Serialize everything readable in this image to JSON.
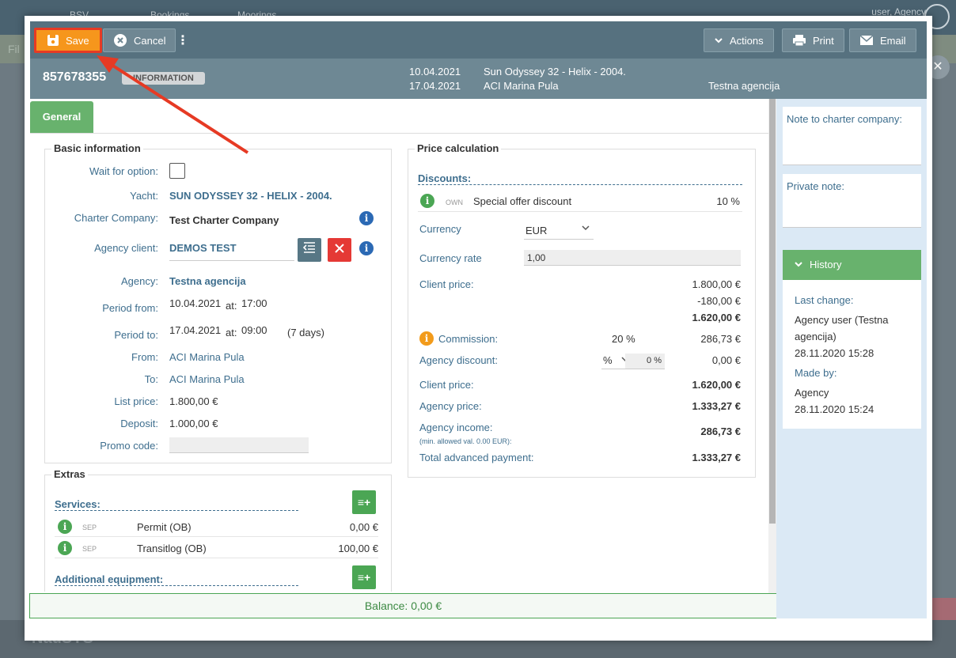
{
  "background": {
    "nav_items": [
      "BSV",
      "Bookings",
      "Moorings"
    ],
    "user_label": "user, Agency",
    "strip_label": "Fil",
    "brand": "NauSYS"
  },
  "toolbar": {
    "save_label": "Save",
    "cancel_label": "Cancel",
    "actions_label": "Actions",
    "print_label": "Print",
    "email_label": "Email"
  },
  "header": {
    "booking_id": "857678355",
    "status_badge": "INFORMATION",
    "date_from": "10.04.2021",
    "date_to": "17.04.2021",
    "yacht": "Sun Odyssey 32 - Helix - 2004.",
    "base": "ACI Marina Pula",
    "agency": "Testna agencija"
  },
  "tabs": [
    {
      "label": "General"
    }
  ],
  "basic_info": {
    "title": "Basic information",
    "wait_for_option_label": "Wait for option:",
    "yacht_label": "Yacht:",
    "yacht_value": "SUN ODYSSEY 32 - HELIX - 2004.",
    "charter_company_label": "Charter Company:",
    "charter_company_value": "Test Charter Company",
    "agency_client_label": "Agency client:",
    "agency_client_value": "DEMOS TEST",
    "agency_label": "Agency:",
    "agency_value": "Testna agencija",
    "period_from_label": "Period from:",
    "period_from_date": "10.04.2021",
    "period_from_at": "at:",
    "period_from_time": "17:00",
    "period_to_label": "Period to:",
    "period_to_date": "17.04.2021",
    "period_to_at": "at:",
    "period_to_time": "09:00",
    "days": "(7 days)",
    "from_label": "From:",
    "from_value": "ACI Marina Pula",
    "to_label": "To:",
    "to_value": "ACI Marina Pula",
    "list_price_label": "List price:",
    "list_price_value": "1.800,00 €",
    "deposit_label": "Deposit:",
    "deposit_value": "1.000,00 €",
    "promo_label": "Promo code:",
    "promo_value": ""
  },
  "extras": {
    "title": "Extras",
    "services_title": "Services:",
    "services": [
      {
        "tag": "SEP",
        "name": "Permit (OB)",
        "price": "0,00 €"
      },
      {
        "tag": "SEP",
        "name": "Transitlog (OB)",
        "price": "100,00 €"
      }
    ],
    "equipment_title": "Additional equipment:"
  },
  "price": {
    "title": "Price calculation",
    "discounts_title": "Discounts:",
    "discount_tag": "OWN",
    "discount_name": "Special offer discount",
    "discount_value": "10 %",
    "currency_label": "Currency",
    "currency_value": "EUR",
    "currency_rate_label": "Currency rate",
    "currency_rate_value": "1,00",
    "client_price_label": "Client price:",
    "client_price_1": "1.800,00 €",
    "client_price_2": "-180,00 €",
    "client_price_3": "1.620,00 €",
    "commission_label": "Commission:",
    "commission_pct": "20 %",
    "commission_value": "286,73 €",
    "agency_discount_label": "Agency discount:",
    "agency_discount_unit": "%",
    "agency_discount_input": "0 %",
    "agency_discount_value": "0,00 €",
    "client_price2_label": "Client price:",
    "client_price2_value": "1.620,00 €",
    "agency_price_label": "Agency price:",
    "agency_price_value": "1.333,27 €",
    "agency_income_label": "Agency income:",
    "agency_income_note": "(min. allowed val. 0.00 EUR):",
    "agency_income_value": "286,73 €",
    "total_adv_label": "Total advanced payment:",
    "total_adv_value": "1.333,27 €"
  },
  "balance": "Balance: 0,00 €",
  "notes": {
    "charter_note_label": "Note to charter company:",
    "private_note_label": "Private note:"
  },
  "history": {
    "title": "History",
    "last_change_label": "Last change:",
    "last_change_user": "Agency user (Testna agencija)",
    "last_change_date": "28.11.2020 15:28",
    "made_by_label": "Made by:",
    "made_by_user": "Agency",
    "made_by_date": "28.11.2020 15:24"
  },
  "colors": {
    "save": "#f6961c",
    "toolbar": "#56717f",
    "green": "#68b26d",
    "annotation": "#e63a24"
  }
}
